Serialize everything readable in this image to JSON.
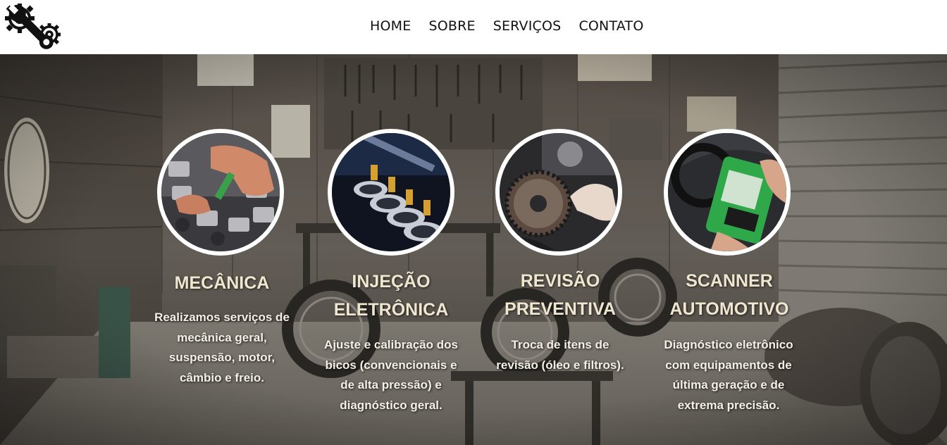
{
  "header": {
    "logo_icon": "gears-wrench-icon",
    "nav": [
      "HOME",
      "SOBRE",
      "SERVIÇOS",
      "CONTATO"
    ]
  },
  "services": [
    {
      "title": "MECÂNICA",
      "description": "Realizamos serviços de mecânica geral, suspensão, motor, câmbio e freio.",
      "image": "engine-valves-photo"
    },
    {
      "title": "INJEÇÃO ELETRÔNICA",
      "description": "Ajuste e calibração dos bicos (convencionais e de alta pressão) e diagnóstico geral.",
      "image": "fuel-injectors-photo"
    },
    {
      "title": "REVISÃO PREVENTIVA",
      "description": "Troca de itens de revisão (óleo e filtros).",
      "image": "timing-belt-photo"
    },
    {
      "title": "SCANNER AUTOMOTIVO",
      "description": "Diagnóstico eletrônico com equipamentos de última geração e de extrema precisão.",
      "image": "diagnostic-scanner-photo"
    }
  ],
  "background_image": "vintage-garage-photo"
}
